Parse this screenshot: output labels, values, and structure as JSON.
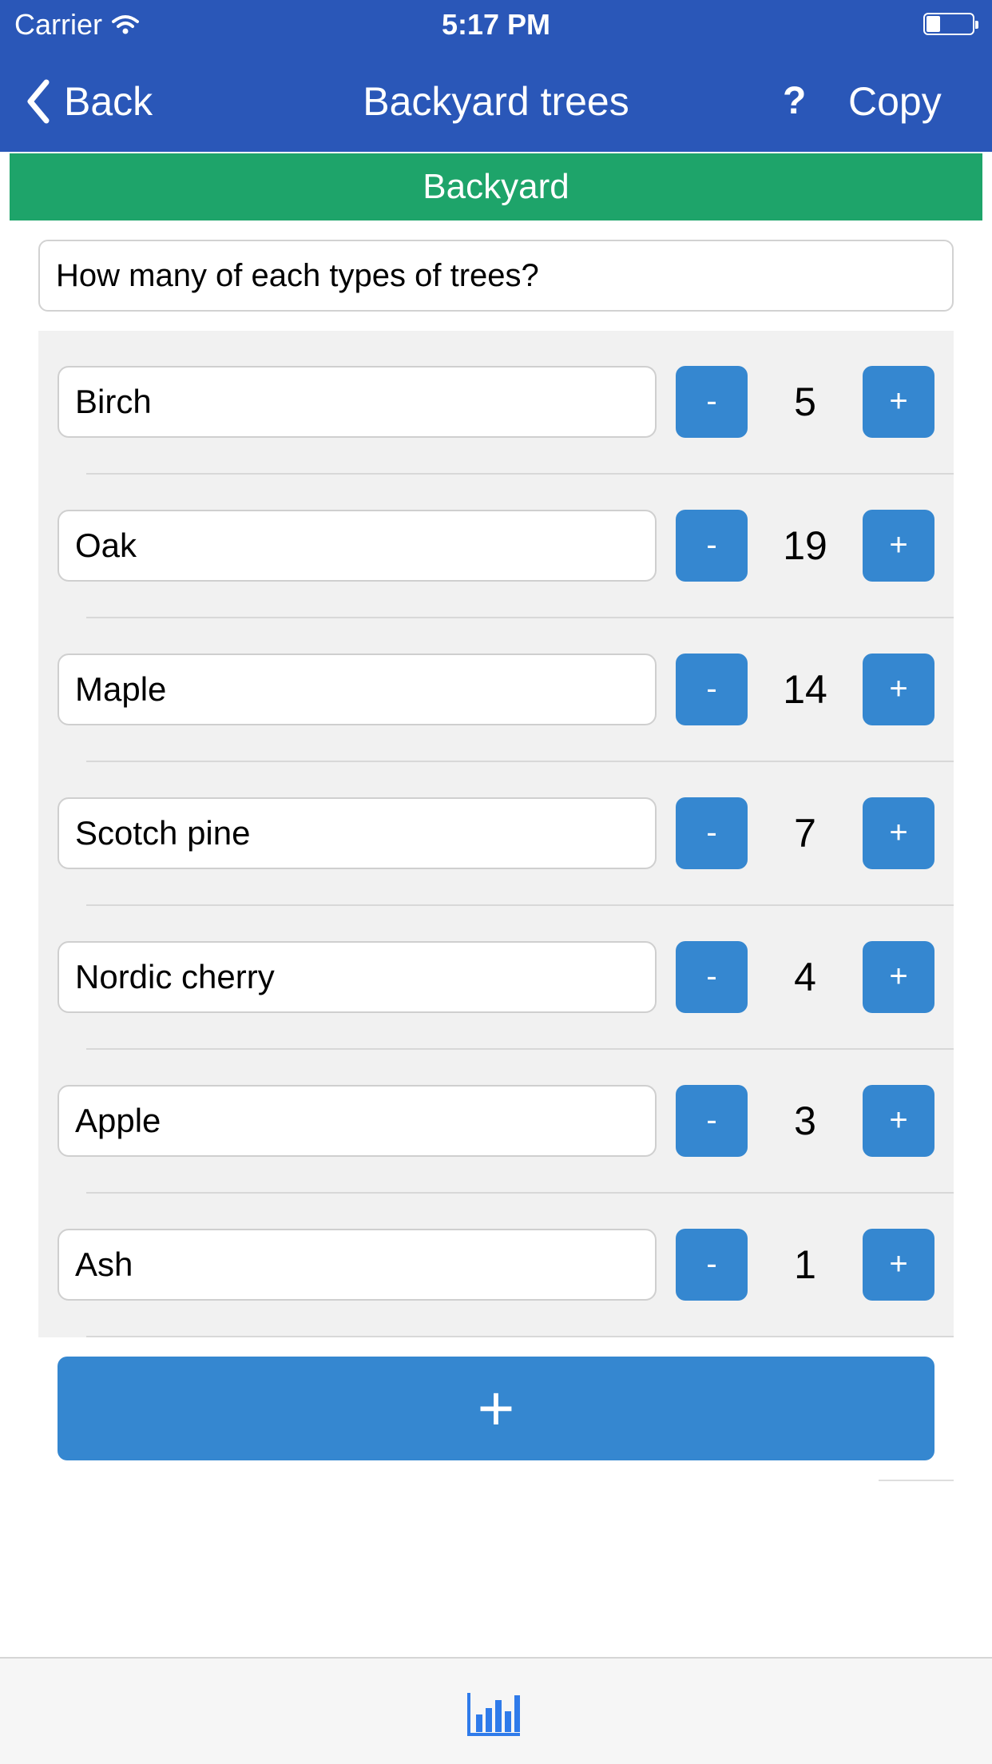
{
  "status_bar": {
    "carrier": "Carrier",
    "time": "5:17 PM",
    "battery_level": 0.3
  },
  "nav": {
    "back_label": "Back",
    "title": "Backyard trees",
    "help_label": "?",
    "copy_label": "Copy"
  },
  "section": {
    "title": "Backyard"
  },
  "question": {
    "text": "How many of each types of trees?"
  },
  "items": [
    {
      "name": "Birch",
      "count": "5"
    },
    {
      "name": "Oak",
      "count": "19"
    },
    {
      "name": "Maple",
      "count": "14"
    },
    {
      "name": "Scotch pine",
      "count": "7"
    },
    {
      "name": "Nordic cherry",
      "count": "4"
    },
    {
      "name": "Apple",
      "count": "3"
    },
    {
      "name": "Ash",
      "count": "1"
    }
  ],
  "controls": {
    "minus_label": "-",
    "plus_label": "+",
    "add_label": "+"
  },
  "bottom_bar": {
    "icon": "bar-chart-icon"
  },
  "colors": {
    "nav_bar": "#2A57B8",
    "section_header": "#1EA46A",
    "button": "#3587D0",
    "icon_blue": "#2F7BEA"
  }
}
